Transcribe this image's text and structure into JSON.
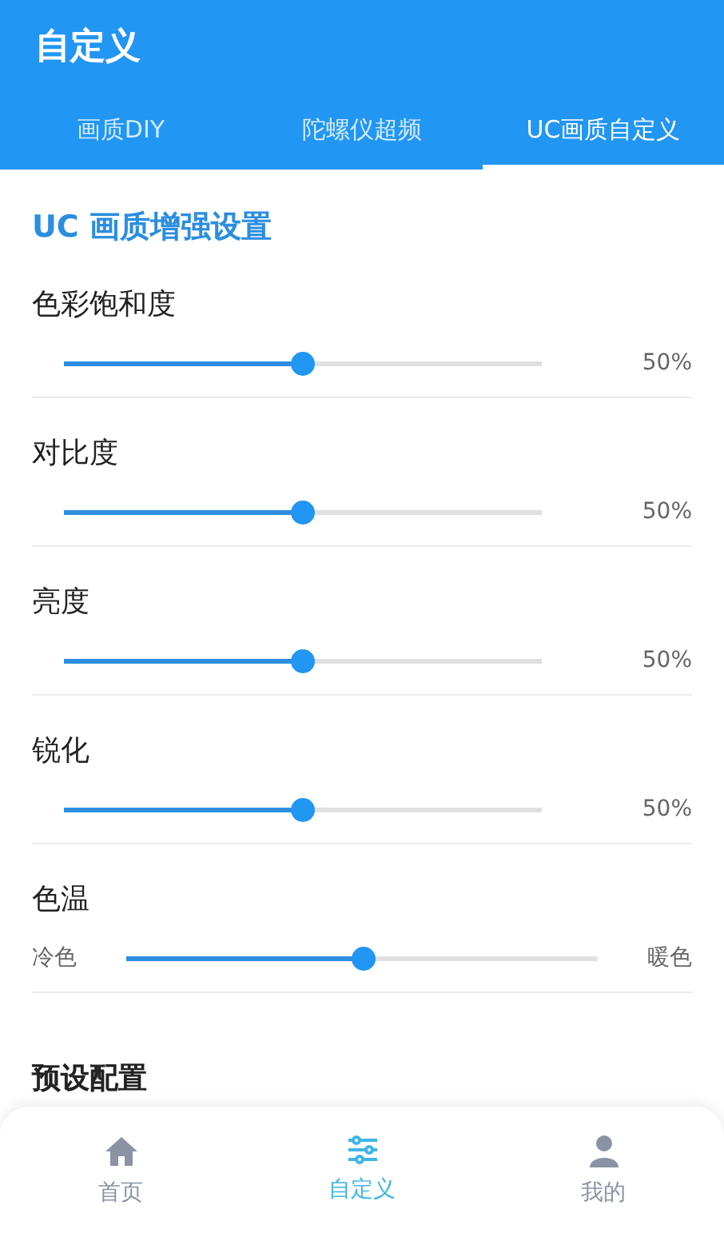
{
  "app_bar": {
    "title": "自定义"
  },
  "tabs": [
    {
      "label": "画质DIY",
      "selected": false
    },
    {
      "label": "陀螺仪超频",
      "selected": false
    },
    {
      "label": "UC画质自定义",
      "selected": true
    }
  ],
  "section_title": "UC 画质增强设置",
  "settings": [
    {
      "kind": "percent",
      "label": "色彩饱和度",
      "level": 0.5,
      "reading": "50%"
    },
    {
      "kind": "percent",
      "label": "对比度",
      "level": 0.5,
      "reading": "50%"
    },
    {
      "kind": "percent",
      "label": "亮度",
      "level": 0.5,
      "reading": "50%"
    },
    {
      "kind": "percent",
      "label": "锐化",
      "level": 0.5,
      "reading": "50%"
    },
    {
      "kind": "range",
      "label": "色温",
      "level": 0.5,
      "min_label": "冷色",
      "max_label": "暖色"
    }
  ],
  "presets_title": "预设配置",
  "bottom_nav": [
    {
      "label": "首页",
      "selected": false
    },
    {
      "label": "自定义",
      "selected": true
    },
    {
      "label": "我的",
      "selected": false
    }
  ]
}
